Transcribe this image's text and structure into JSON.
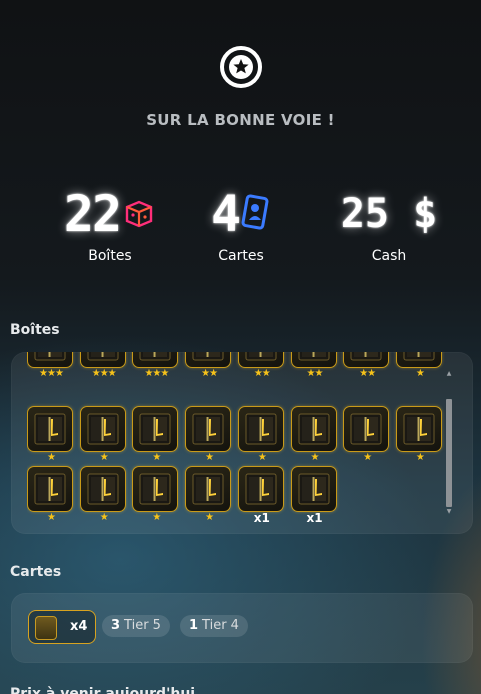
{
  "header": {
    "badge_icon": "star-circle-icon",
    "title": "SUR LA BONNE VOIE !"
  },
  "stats": [
    {
      "value": "22",
      "label": "Boîtes",
      "icon": "box-icon",
      "icon_color": "#ff2e7a"
    },
    {
      "value": "4",
      "label": "Cartes",
      "icon": "card-icon",
      "icon_color": "#3b7bff"
    },
    {
      "value": "25 $",
      "label": "Cash"
    }
  ],
  "boxes_section": {
    "title": "Boîtes",
    "rows": [
      [
        "★★★",
        "★★★",
        "★★★",
        "★★",
        "★★",
        "★★",
        "★★",
        "★"
      ],
      [
        "★",
        "★",
        "★",
        "★",
        "★",
        "★",
        "★",
        "★"
      ],
      [
        "★",
        "★",
        "★",
        "★",
        "x1",
        "x1"
      ]
    ]
  },
  "cards_section": {
    "title": "Cartes",
    "card_quantity": "x4",
    "tiers": [
      {
        "count": "3",
        "label": "Tier 5"
      },
      {
        "count": "1",
        "label": "Tier 4"
      }
    ]
  },
  "next_section": {
    "title": "Prix à venir aujourd'hui"
  }
}
